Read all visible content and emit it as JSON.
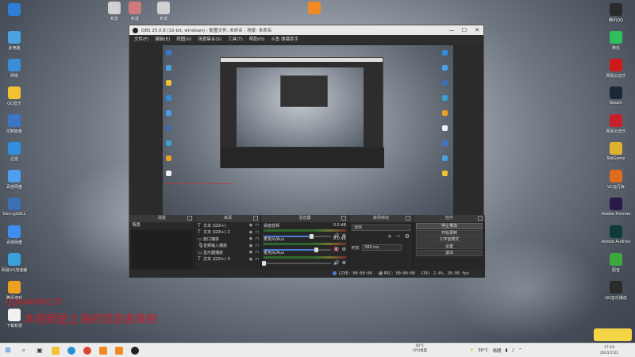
{
  "desktop": {
    "left_icons": [
      {
        "label": "",
        "color": "#2d7fd8"
      },
      {
        "label": "此电脑",
        "color": "#4aa3e0"
      },
      {
        "label": "网络",
        "color": "#3c8fd6"
      },
      {
        "label": "QQ音乐",
        "color": "#f2c233"
      },
      {
        "label": "控制面板",
        "color": "#3b76c8"
      },
      {
        "label": "迅雷",
        "color": "#2f8ee0"
      },
      {
        "label": "百度网盘",
        "color": "#4e9ff0"
      },
      {
        "label": "DecryptDLL",
        "color": "#3d6fb3"
      },
      {
        "label": "百度网盘",
        "color": "#3f8ded"
      },
      {
        "label": "网易UU加速器",
        "color": "#3aa0d8"
      },
      {
        "label": "腾讯游戏",
        "color": "#f0a020"
      },
      {
        "label": "下载新建",
        "color": "#f2f2f2"
      }
    ],
    "top_icons": [
      {
        "label": "新建",
        "color": "#d0d0d0"
      },
      {
        "label": "新建",
        "color": "#d07b7b"
      },
      {
        "label": "新建",
        "color": "#d0d0d0"
      },
      {
        "label": "",
        "color": "#f08a24"
      }
    ],
    "right_icons": [
      {
        "label": "腾讯QQ",
        "color": "#2b2b2b"
      },
      {
        "label": "微信",
        "color": "#2fbf5b"
      },
      {
        "label": "网易云音乐",
        "color": "#d01a1a"
      },
      {
        "label": "Steam",
        "color": "#1b2838"
      },
      {
        "label": "网易云音乐",
        "color": "#c8202a"
      },
      {
        "label": "WeGame",
        "color": "#e0b030"
      },
      {
        "label": "VC运行库",
        "color": "#e06a20"
      },
      {
        "label": "Adobe Premiere",
        "color": "#2a1a4a"
      },
      {
        "label": "Adobe Audition",
        "color": "#0f3b3a"
      },
      {
        "label": "配音",
        "color": "#3da83d"
      },
      {
        "label": "QQ音乐播放",
        "color": "#2a2a2a"
      }
    ],
    "overlay_number": "QQ644984175",
    "overlay_text": "本视频是上海的流浪者录制"
  },
  "obs": {
    "title": "OBS 25.0.8 (32-bit, windows) - 配置文件: 未命名 - 场景: 未命名",
    "window_buttons": [
      "—",
      "☐",
      "✕"
    ],
    "menu": [
      "文件(F)",
      "编辑(E)",
      "视图(V)",
      "场景集合(S)",
      "工具(T)",
      "帮助(H)",
      "斗鱼 弹幕助手"
    ],
    "docks": {
      "scenes": {
        "title": "场景",
        "items": [
          "场景"
        ]
      },
      "sources": {
        "title": "来源",
        "items": [
          "文本 (GDI+)",
          "文本 (GDI+) 2",
          "窗口捕获",
          "音频输入捕获",
          "显示器捕获",
          "文本 (GDI+) 3"
        ]
      },
      "mixer": {
        "title": "混音器",
        "channels": [
          {
            "name": "桌面音频",
            "db": "0.0 dB",
            "level": 0.7,
            "muted": false
          },
          {
            "name": "麦克风/Aux",
            "db": "0.0 dB",
            "level": 0.78,
            "muted": true
          },
          {
            "name": "麦克风/Aux",
            "db": "",
            "level": 0.0,
            "muted": false
          }
        ]
      },
      "transitions": {
        "title": "转场特效",
        "selected": "淡出",
        "duration_label": "时长",
        "duration_value": "300 ms"
      },
      "controls": {
        "title": "控件",
        "buttons": [
          "停止推流",
          "开始录制",
          "工作室模式",
          "设置",
          "退出"
        ]
      }
    },
    "status": {
      "live_label": "LIVE:",
      "live_time": "00:00:00",
      "rec_label": "REC:",
      "rec_time": "00:00:00",
      "cpu": "CPU: 2.4%, 30.00 fps"
    }
  },
  "taskbar": {
    "weather_temp": "40°C",
    "weather_label": "CPU温度",
    "tray_temp": "36°C",
    "tray_weather": "晴朗",
    "time": "17:19",
    "date": "2021/7/21",
    "apps": [
      {
        "name": "search-icon",
        "color": "#444"
      },
      {
        "name": "task-view-icon",
        "color": "#444"
      },
      {
        "name": "file-explorer-icon",
        "color": "#f2c233"
      },
      {
        "name": "edge-icon",
        "color": "#2b8fd6"
      },
      {
        "name": "chrome-icon",
        "color": "#db4437"
      },
      {
        "name": "orange-app-icon",
        "color": "#f08a24"
      },
      {
        "name": "orange-app-icon",
        "color": "#f08a24"
      },
      {
        "name": "obs-icon",
        "color": "#222"
      }
    ]
  }
}
